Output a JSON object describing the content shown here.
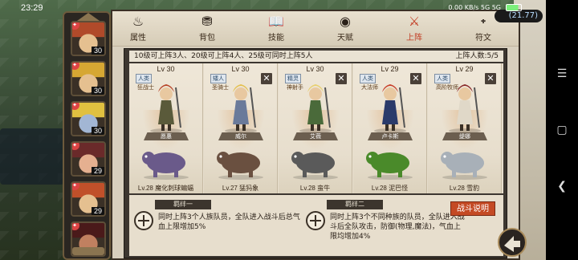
{
  "status_bar": {
    "time": "23:29",
    "right_text": "0.00 KB/s  5G  5G"
  },
  "resource": {
    "value": "(21.77)"
  },
  "tabs": [
    {
      "label": "属性",
      "icon": "flame-icon",
      "active": false
    },
    {
      "label": "背包",
      "icon": "backpack-icon",
      "active": false
    },
    {
      "label": "技能",
      "icon": "book-icon",
      "active": false
    },
    {
      "label": "天赋",
      "icon": "eye-icon",
      "active": false
    },
    {
      "label": "上阵",
      "icon": "swords-icon",
      "active": true
    },
    {
      "label": "符文",
      "icon": "rune-icon",
      "active": false
    }
  ],
  "info": {
    "rule": "10级可上阵3人、20级可上阵4人、25级可同时上阵5人",
    "count": "上阵人数:5/5"
  },
  "avatars": [
    {
      "level": "30",
      "colors": [
        "#b04a2a",
        "#e5c090"
      ]
    },
    {
      "level": "30",
      "colors": [
        "#d6a733",
        "#e5c090"
      ]
    },
    {
      "level": "30",
      "colors": [
        "#e0c040",
        "#a2b6d4"
      ]
    },
    {
      "level": "29",
      "colors": [
        "#6a2a2a",
        "#e5b090"
      ]
    },
    {
      "level": "29",
      "colors": [
        "#c0502a",
        "#e5c090"
      ]
    },
    {
      "level": "",
      "colors": [
        "#4a1a1a",
        "#c08060"
      ]
    }
  ],
  "heroes": [
    {
      "level": "Lv 30",
      "race": "人类",
      "role": "狂战士",
      "name": "愿惠",
      "hair": "#b8462a",
      "outfit": "#5a5a3a",
      "removable": false,
      "beast_level": "Lv.28",
      "beast_name": "魔化刺球蝙蝠",
      "beast_color": "#6a5a8a"
    },
    {
      "level": "Lv 30",
      "race": "矮人",
      "role": "圣骑士",
      "name": "威尔",
      "hair": "#e4c050",
      "outfit": "#6a7a9a",
      "removable": true,
      "beast_level": "Lv.27",
      "beast_name": "猛犸象",
      "beast_color": "#6a5040"
    },
    {
      "level": "Lv 30",
      "race": "精灵",
      "role": "神射手",
      "name": "艾薇",
      "hair": "#e8d070",
      "outfit": "#4a6a3a",
      "removable": true,
      "beast_level": "Lv.28",
      "beast_name": "蛮牛",
      "beast_color": "#5a5a5a"
    },
    {
      "level": "Lv 29",
      "race": "人类",
      "role": "大法师",
      "name": "卢卡斯",
      "hair": "#c8402a",
      "outfit": "#2a3a6a",
      "removable": true,
      "beast_level": "Lv.28",
      "beast_name": "泥巴怪",
      "beast_color": "#4a8a2a"
    },
    {
      "level": "Lv 29",
      "race": "人类",
      "role": "高阶牧师",
      "name": "缇娜",
      "hair": "#8a2a2a",
      "outfit": "#e0d8c8",
      "removable": true,
      "beast_level": "Lv.28",
      "beast_name": "雪豹",
      "beast_color": "#a8b0b8"
    }
  ],
  "bonds": [
    {
      "title": "羁绊一",
      "desc": "同时上阵3个人族队员，全队进入战斗后总气血上限增加5%"
    },
    {
      "title": "羁绊二",
      "desc": "同时上阵3个不同种族的队员，全队进入战斗后全队攻击，防御(物理,魔法)，气血上限均增加4%"
    }
  ],
  "battle_button": "战斗说明",
  "colors": {
    "accent": "#c23b22",
    "panel": "#d8cfbe",
    "dark": "#3c3630"
  }
}
